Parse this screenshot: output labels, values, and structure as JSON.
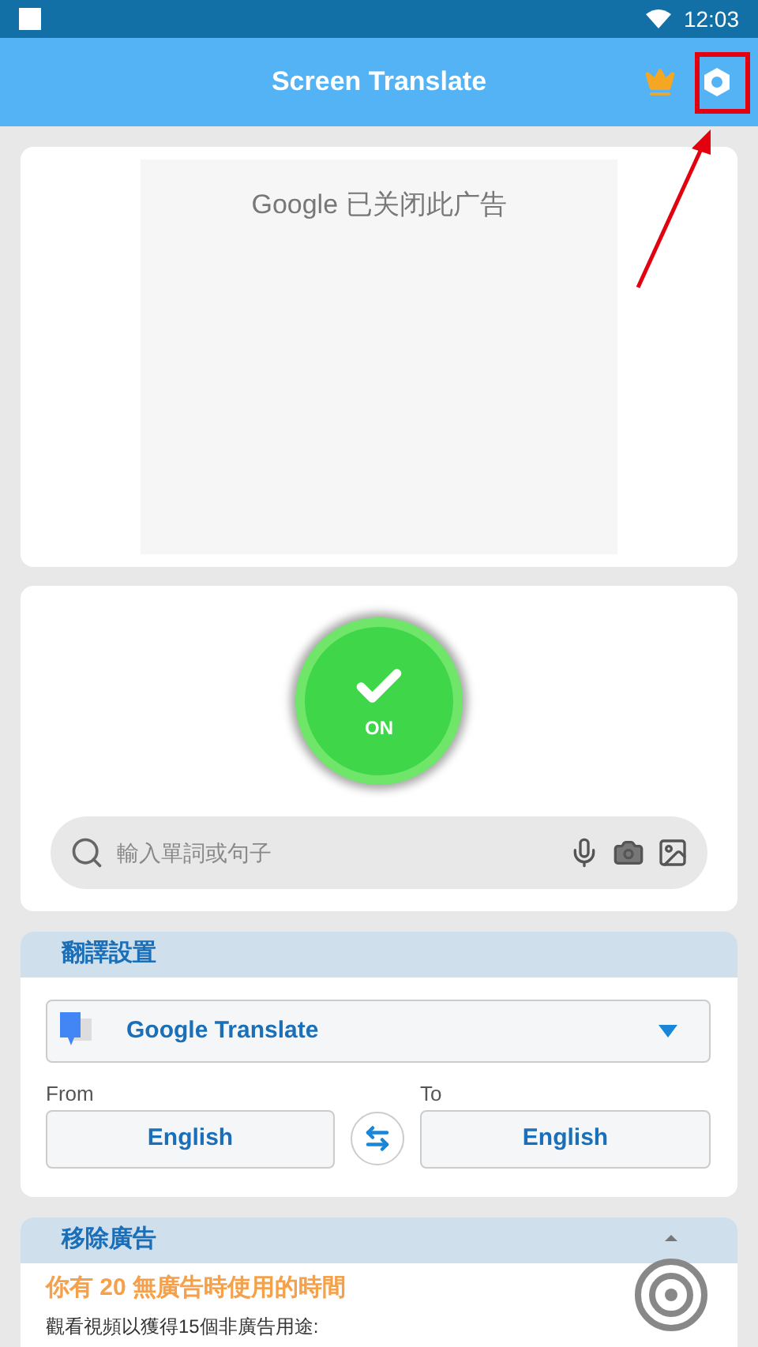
{
  "status_bar": {
    "time": "12:03"
  },
  "app_bar": {
    "title": "Screen Translate"
  },
  "ad": {
    "text": "Google 已关闭此广告"
  },
  "power": {
    "on": true,
    "label": "ON"
  },
  "search": {
    "placeholder": "輸入單詞或句子"
  },
  "translate_settings": {
    "heading": "翻譯設置",
    "engine": "Google Translate",
    "from_label": "From",
    "from": "English",
    "to_label": "To",
    "to": "English"
  },
  "remove_ads": {
    "heading": "移除廣告",
    "notice": "你有 20 無廣告時使用的時間",
    "detail": "觀看視頻以獲得15個非廣告用途:"
  }
}
